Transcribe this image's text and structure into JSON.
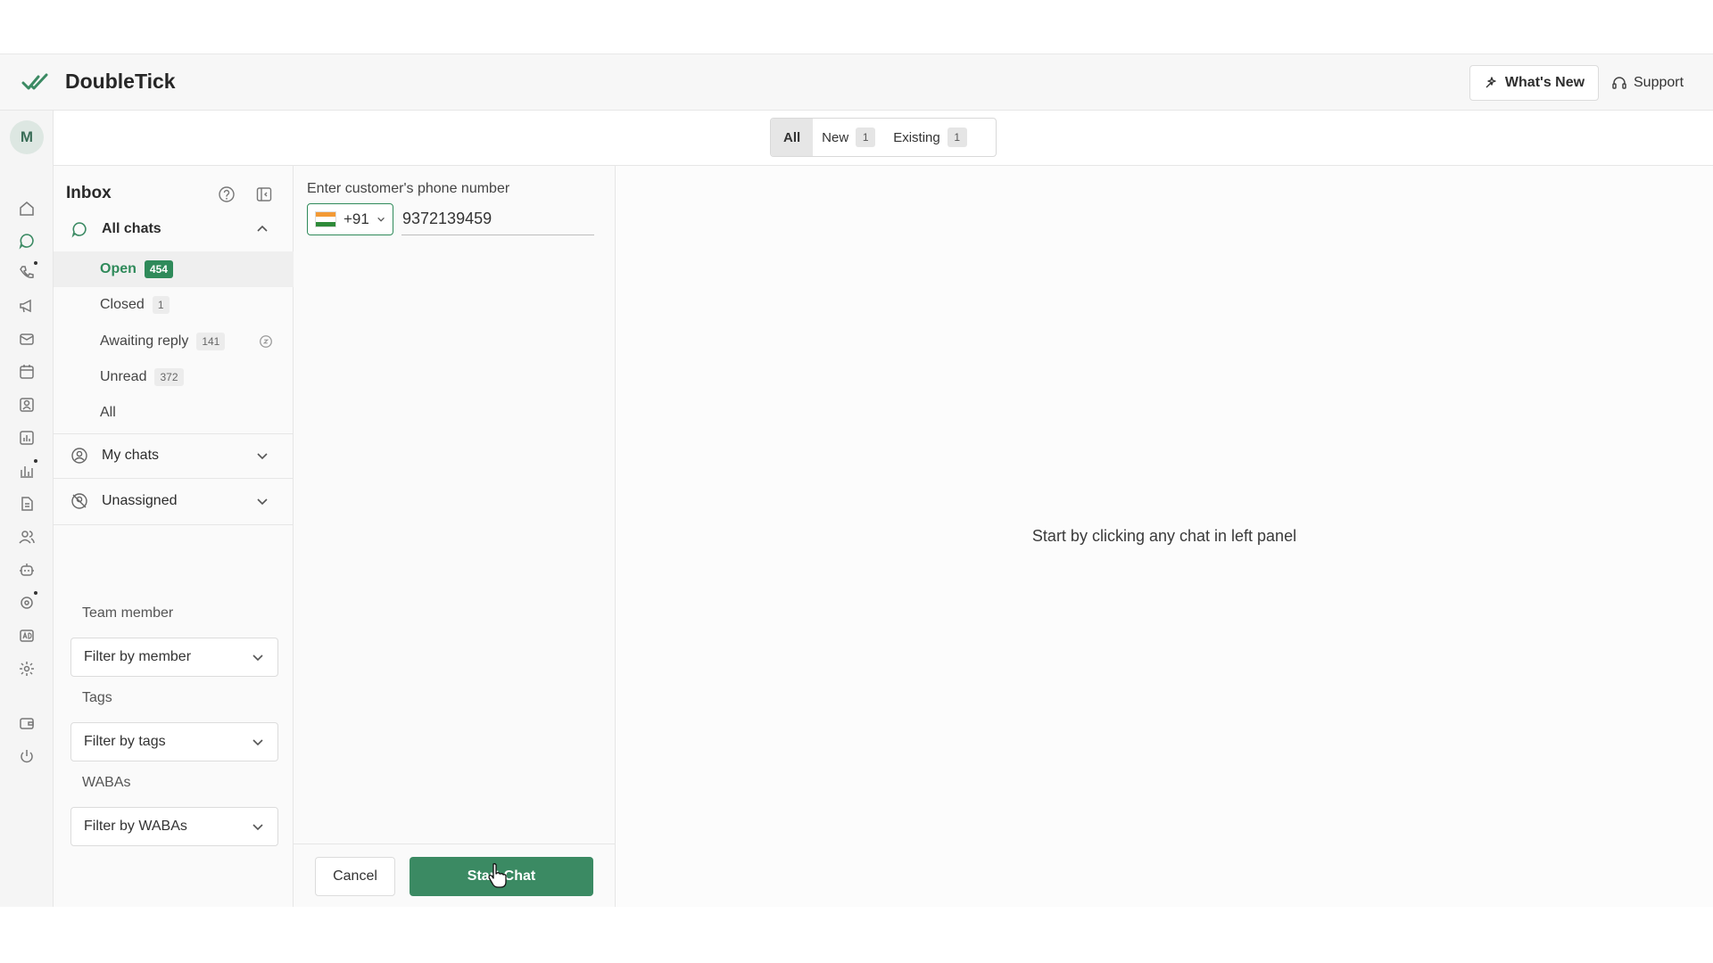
{
  "app": {
    "title": "DoubleTick",
    "accent": "#2f8a5a"
  },
  "header": {
    "whats_new_label": "What's New",
    "support_label": "Support"
  },
  "user": {
    "avatar_initial": "M"
  },
  "tabs": [
    {
      "label": "All",
      "count": null,
      "active": true
    },
    {
      "label": "New",
      "count": "1",
      "active": false
    },
    {
      "label": "Existing",
      "count": "1",
      "active": false
    }
  ],
  "rail": {
    "icons": [
      "home-icon",
      "chat-icon",
      "phone-icon",
      "megaphone-icon",
      "mail-icon",
      "calendar-icon",
      "contact-card-icon",
      "report-icon",
      "analytics-icon",
      "document-icon",
      "users-icon",
      "bot-icon",
      "integration-icon",
      "ads-icon",
      "settings-icon",
      "wallet-icon",
      "power-icon"
    ]
  },
  "inbox": {
    "title": "Inbox",
    "all_chats": {
      "label": "All chats",
      "items": [
        {
          "label": "Open",
          "count": "454"
        },
        {
          "label": "Closed",
          "count": "1"
        },
        {
          "label": "Awaiting reply",
          "count": "141"
        },
        {
          "label": "Unread",
          "count": "372"
        },
        {
          "label": "All",
          "count": null
        }
      ]
    },
    "my_chats_label": "My chats",
    "unassigned_label": "Unassigned",
    "filters": {
      "team_member_label": "Team member",
      "team_member_placeholder": "Filter by member",
      "tags_label": "Tags",
      "tags_placeholder": "Filter by tags",
      "wabas_label": "WABAs",
      "wabas_placeholder": "Filter by WABAs"
    }
  },
  "new_chat": {
    "label": "Enter customer's phone number",
    "country_code": "+91",
    "phone_value": "9372139459",
    "cancel_label": "Cancel",
    "start_label": "Start Chat"
  },
  "main": {
    "empty_message": "Start by clicking any chat in left panel"
  }
}
